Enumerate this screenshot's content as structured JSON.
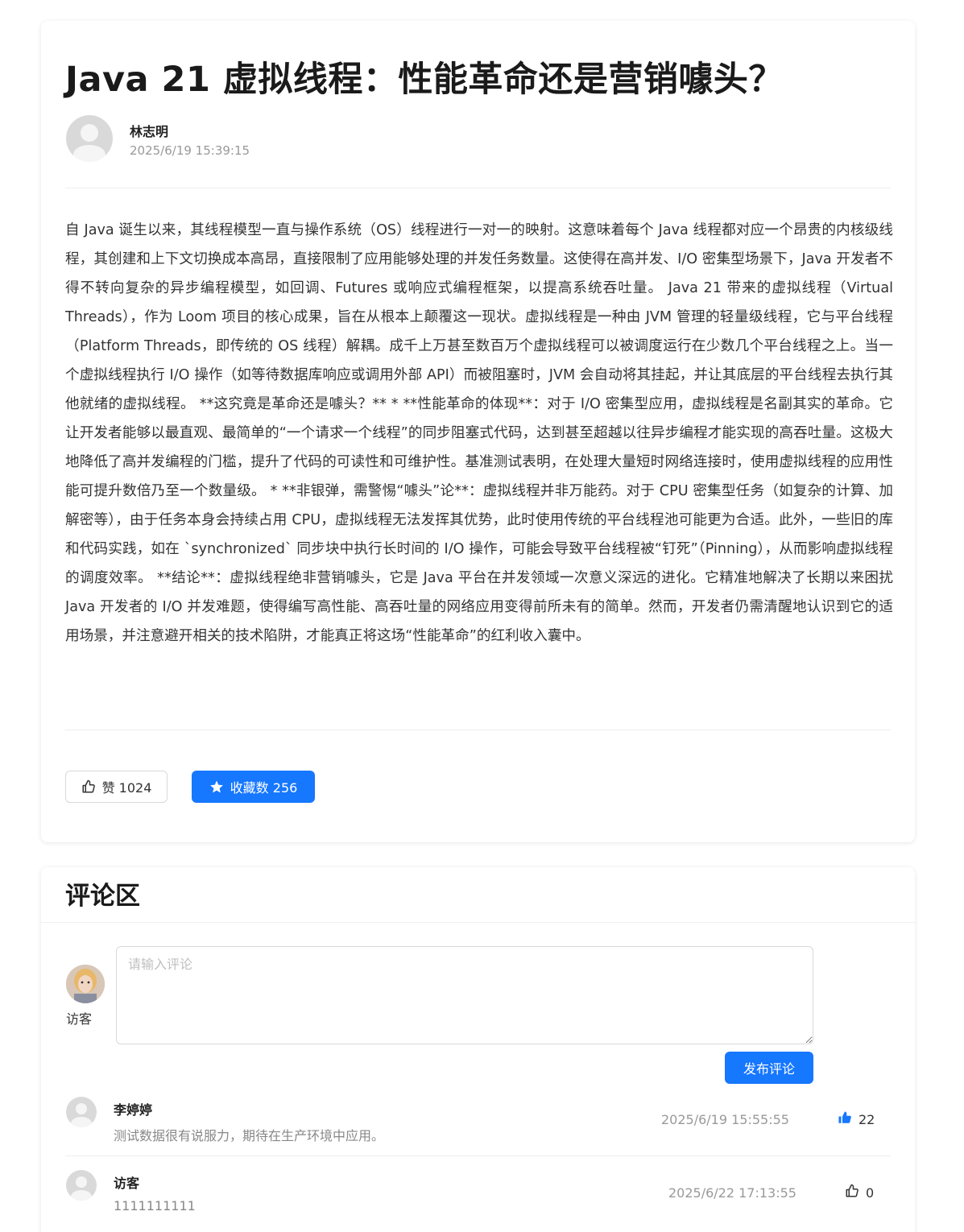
{
  "article": {
    "title": "Java 21 虚拟线程：性能革命还是营销噱头？",
    "author": "林志明",
    "time": "2025/6/19 15:39:15",
    "content": "自 Java 诞生以来，其线程模型一直与操作系统（OS）线程进行一对一的映射。这意味着每个 Java 线程都对应一个昂贵的内核级线程，其创建和上下文切换成本高昂，直接限制了应用能够处理的并发任务数量。这使得在高并发、I/O 密集型场景下，Java 开发者不得不转向复杂的异步编程模型，如回调、Futures 或响应式编程框架，以提高系统吞吐量。 Java 21 带来的虚拟线程（Virtual Threads），作为 Loom 项目的核心成果，旨在从根本上颠覆这一现状。虚拟线程是一种由 JVM 管理的轻量级线程，它与平台线程（Platform Threads，即传统的 OS 线程）解耦。成千上万甚至数百万个虚拟线程可以被调度运行在少数几个平台线程之上。当一个虚拟线程执行 I/O 操作（如等待数据库响应或调用外部 API）而被阻塞时，JVM 会自动将其挂起，并让其底层的平台线程去执行其他就绪的虚拟线程。 **这究竟是革命还是噱头？** * **性能革命的体现**：对于 I/O 密集型应用，虚拟线程是名副其实的革命。它让开发者能够以最直观、最简单的“一个请求一个线程”的同步阻塞式代码，达到甚至超越以往异步编程才能实现的高吞吐量。这极大地降低了高并发编程的门槛，提升了代码的可读性和可维护性。基准测试表明，在处理大量短时网络连接时，使用虚拟线程的应用性能可提升数倍乃至一个数量级。 * **非银弹，需警惕“噱头”论**：虚拟线程并非万能药。对于 CPU 密集型任务（如复杂的计算、加解密等），由于任务本身会持续占用 CPU，虚拟线程无法发挥其优势，此时使用传统的平台线程池可能更为合适。此外，一些旧的库和代码实践，如在 `synchronized` 同步块中执行长时间的 I/O 操作，可能会导致平台线程被“钉死”（Pinning），从而影响虚拟线程的调度效率。 **结论**：虚拟线程绝非营销噱头，它是 Java 平台在并发领域一次意义深远的进化。它精准地解决了长期以来困扰 Java 开发者的 I/O 并发难题，使得编写高性能、高吞吐量的网络应用变得前所未有的简单。然而，开发者仍需清醒地认识到它的适用场景，并注意避开相关的技术陷阱，才能真正将这场“性能革命”的红利收入囊中。",
    "like_label": "赞 1024",
    "fav_label": "收藏数 256"
  },
  "comments": {
    "title": "评论区",
    "guest_label": "访客",
    "input_placeholder": "请输入评论",
    "post_label": "发布评论",
    "items": [
      {
        "name": "李婷婷",
        "text": "测试数据很有说服力，期待在生产环境中应用。",
        "time": "2025/6/19 15:55:55",
        "likes": "22",
        "liked": true
      },
      {
        "name": "访客",
        "text": "1111111111",
        "time": "2025/6/22 17:13:55",
        "likes": "0",
        "liked": false
      }
    ]
  },
  "colors": {
    "primary": "#1677ff",
    "muted": "#999999"
  },
  "icons": {
    "like": "thumbs-up-icon",
    "favorite": "star-icon"
  }
}
